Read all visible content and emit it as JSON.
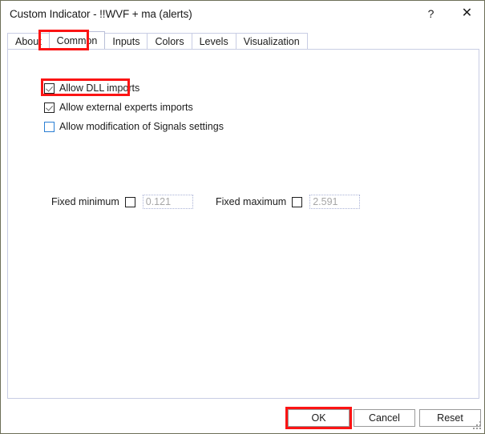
{
  "window": {
    "title": "Custom Indicator - !!WVF + ma (alerts)",
    "help_glyph": "?",
    "close_glyph": "✕",
    "border_color": "#6d6f58",
    "background": "#ffffff"
  },
  "tabs": [
    {
      "label": "About",
      "selected": false
    },
    {
      "label": "Common",
      "selected": true
    },
    {
      "label": "Inputs",
      "selected": false
    },
    {
      "label": "Colors",
      "selected": false
    },
    {
      "label": "Levels",
      "selected": false
    },
    {
      "label": "Visualization",
      "selected": false
    }
  ],
  "common": {
    "checkboxes": [
      {
        "label": "Allow DLL imports",
        "checked": true
      },
      {
        "label": "Allow external experts imports",
        "checked": true
      },
      {
        "label": "Allow modification of Signals settings",
        "checked": false
      }
    ],
    "fixed_minimum": {
      "label": "Fixed minimum",
      "checked": false,
      "value": "0.121"
    },
    "fixed_maximum": {
      "label": "Fixed maximum",
      "checked": false,
      "value": "2.591"
    }
  },
  "buttons": {
    "ok": "OK",
    "cancel": "Cancel",
    "reset": "Reset"
  },
  "annotations": {
    "color": "#fb1414",
    "highlighted": [
      "Common",
      "Allow DLL imports",
      "OK"
    ]
  }
}
